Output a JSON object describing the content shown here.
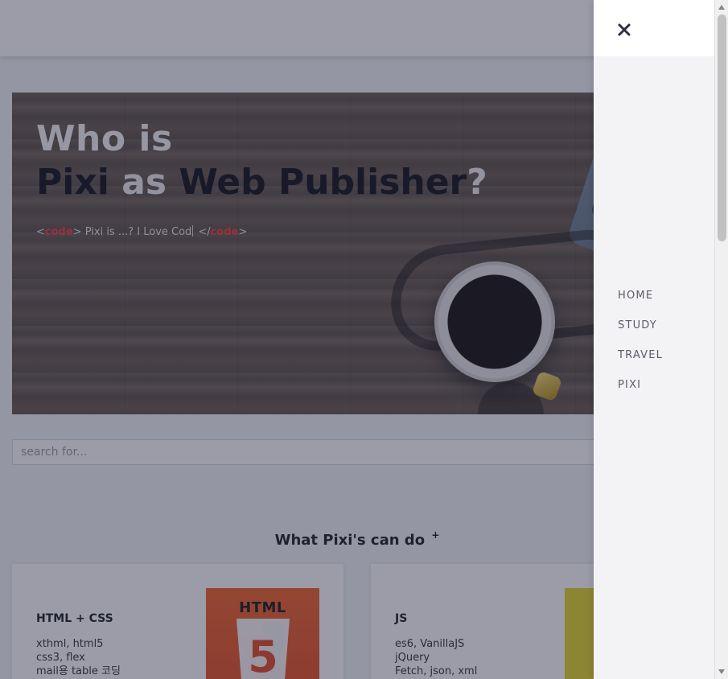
{
  "hero": {
    "title_line1": "Who is",
    "title_line2_part1": "Pixi",
    "title_line2_part2": "as",
    "title_line2_part3": "Web Publisher",
    "title_line2_part4": "?",
    "code_open_lt": "<",
    "code_open_tag": "code",
    "code_open_gt": ">",
    "code_text": " Pixi is ...? I Love Cod",
    "code_close_lt": "</",
    "code_close_tag": "code",
    "code_close_gt": ">"
  },
  "search": {
    "placeholder": "search for..."
  },
  "skills": {
    "title": "What Pixi's can do",
    "title_plus": "+",
    "cards": [
      {
        "title": "HTML + CSS",
        "lines": [
          "xthml, html5",
          "css3, flex",
          "mail용 table 코딩"
        ],
        "badge_word": "HTML",
        "badge_number": "5"
      },
      {
        "title": "JS",
        "lines": [
          "es6, VanillaJS",
          "jQuery",
          "Fetch, json, xml"
        ]
      }
    ]
  },
  "drawer": {
    "close_label": "×",
    "nav_items": [
      "HOME",
      "STUDY",
      "TRAVEL",
      "PIXI"
    ]
  },
  "icons": {
    "close": "close-icon",
    "scroll_up": "chevron-up-icon",
    "scroll_down": "chevron-down-icon"
  },
  "colors": {
    "overlay": "#21243D",
    "drawer_bg": "#F3F3F6",
    "accent_code": "#FF3B3B",
    "nav_text": "#5B5B66"
  }
}
